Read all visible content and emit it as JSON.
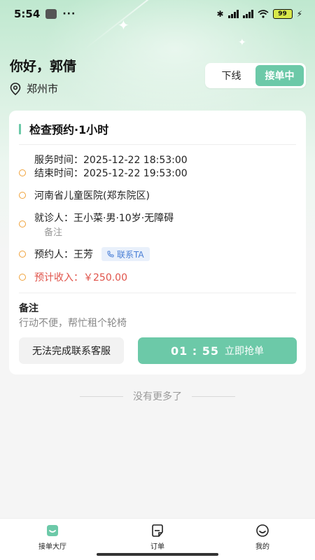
{
  "status_bar": {
    "time": "5:54",
    "more": "···",
    "battery": "99"
  },
  "greeting": "你好，郭倩",
  "location": "郑州市",
  "toggle": {
    "offline": "下线",
    "online": "接单中",
    "active": "online"
  },
  "card": {
    "title": "检查预约·1小时",
    "service_time": "服务时间：2025-12-22 18:53:00",
    "end_time": "结束时间：2025-12-22 19:53:00",
    "hospital": "河南省儿童医院(郑东院区)",
    "patient": "就诊人：王小菜·男·10岁·无障碍",
    "patient_note": "备注",
    "booker": "预约人：王芳",
    "contact": "联系TA",
    "income": "预计收入：￥250.00",
    "remark_title": "备注",
    "remark_text": "行动不便，帮忙租个轮椅",
    "cant_complete": "无法完成联系客服",
    "countdown": "01 : 55",
    "grab": "立即抢单"
  },
  "no_more": "没有更多了",
  "nav": [
    {
      "label": "接单大厅",
      "icon": "hall-icon",
      "active": true
    },
    {
      "label": "订单",
      "icon": "order-icon",
      "active": false
    },
    {
      "label": "我的",
      "icon": "profile-icon",
      "active": false
    }
  ],
  "colors": {
    "accent": "#6cc9a8",
    "income": "#e0534a",
    "ring": "#f0a23a",
    "chip_text": "#4a7fd6"
  }
}
